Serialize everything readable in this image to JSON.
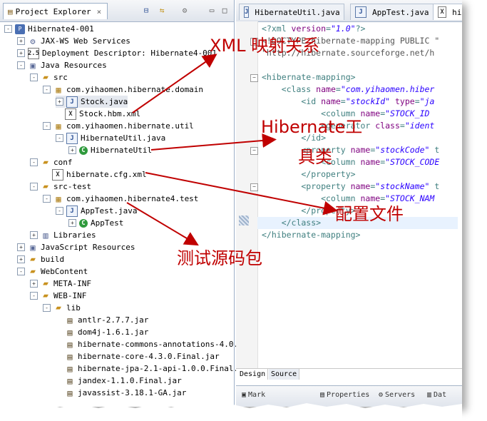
{
  "explorer": {
    "tab_title": "Project Explorer",
    "rows": [
      {
        "label": "Hibernate4-001",
        "indent": 0,
        "exp": "-",
        "icon": "project-icon",
        "glyph": "P",
        "cls": "proj"
      },
      {
        "label": "JAX-WS Web Services",
        "indent": 1,
        "exp": "+",
        "icon": "web-services-icon",
        "glyph": "⚙",
        "cls": "lib"
      },
      {
        "label": "Deployment Descriptor: Hibernate4-001",
        "indent": 1,
        "exp": "+",
        "icon": "deployment-descriptor-icon",
        "glyph": "2.5",
        "cls": "xfile"
      },
      {
        "label": "Java Resources",
        "indent": 1,
        "exp": "-",
        "icon": "java-resources-icon",
        "glyph": "▣",
        "cls": "lib"
      },
      {
        "label": "src",
        "indent": 2,
        "exp": "-",
        "icon": "source-folder-icon",
        "glyph": "▰",
        "cls": "fold"
      },
      {
        "label": "com.yihaomen.hibernate.domain",
        "indent": 3,
        "exp": "-",
        "icon": "package-icon",
        "glyph": "▦",
        "cls": "pkg"
      },
      {
        "label": "Stock.java",
        "indent": 4,
        "exp": "+",
        "icon": "java-file-icon",
        "glyph": "J",
        "cls": "jfile",
        "sel": true
      },
      {
        "label": "Stock.hbm.xml",
        "indent": 4,
        "exp": "",
        "icon": "xml-file-icon",
        "glyph": "X",
        "cls": "xfile"
      },
      {
        "label": "com.yihaomen.hibernate.util",
        "indent": 3,
        "exp": "-",
        "icon": "package-icon",
        "glyph": "▦",
        "cls": "pkg"
      },
      {
        "label": "HibernateUtil.java",
        "indent": 4,
        "exp": "-",
        "icon": "java-file-icon",
        "glyph": "J",
        "cls": "jfile"
      },
      {
        "label": "HibernateUtil",
        "indent": 5,
        "exp": "+",
        "icon": "class-icon",
        "glyph": "C",
        "cls": "cls"
      },
      {
        "label": "conf",
        "indent": 2,
        "exp": "-",
        "icon": "source-folder-icon",
        "glyph": "▰",
        "cls": "fold"
      },
      {
        "label": "hibernate.cfg.xml",
        "indent": 3,
        "exp": "",
        "icon": "xml-file-icon",
        "glyph": "X",
        "cls": "xfile"
      },
      {
        "label": "src-test",
        "indent": 2,
        "exp": "-",
        "icon": "source-folder-icon",
        "glyph": "▰",
        "cls": "fold"
      },
      {
        "label": "com.yihaomen.hibernate4.test",
        "indent": 3,
        "exp": "-",
        "icon": "package-icon",
        "glyph": "▦",
        "cls": "pkg"
      },
      {
        "label": "AppTest.java",
        "indent": 4,
        "exp": "-",
        "icon": "java-file-icon",
        "glyph": "J",
        "cls": "jfile"
      },
      {
        "label": "AppTest",
        "indent": 5,
        "exp": "+",
        "icon": "class-icon",
        "glyph": "C",
        "cls": "cls"
      },
      {
        "label": "Libraries",
        "indent": 2,
        "exp": "+",
        "icon": "libraries-icon",
        "glyph": "▥",
        "cls": "lib"
      },
      {
        "label": "JavaScript Resources",
        "indent": 1,
        "exp": "+",
        "icon": "javascript-resources-icon",
        "glyph": "▣",
        "cls": "lib"
      },
      {
        "label": "build",
        "indent": 1,
        "exp": "+",
        "icon": "folder-icon",
        "glyph": "▰",
        "cls": "fold"
      },
      {
        "label": "WebContent",
        "indent": 1,
        "exp": "-",
        "icon": "folder-icon",
        "glyph": "▰",
        "cls": "fold"
      },
      {
        "label": "META-INF",
        "indent": 2,
        "exp": "+",
        "icon": "folder-icon",
        "glyph": "▰",
        "cls": "fold"
      },
      {
        "label": "WEB-INF",
        "indent": 2,
        "exp": "-",
        "icon": "folder-icon",
        "glyph": "▰",
        "cls": "fold"
      },
      {
        "label": "lib",
        "indent": 3,
        "exp": "-",
        "icon": "folder-icon",
        "glyph": "▰",
        "cls": "fold"
      },
      {
        "label": "antlr-2.7.7.jar",
        "indent": 4,
        "exp": "",
        "icon": "jar-icon",
        "glyph": "▤",
        "cls": "jar"
      },
      {
        "label": "dom4j-1.6.1.jar",
        "indent": 4,
        "exp": "",
        "icon": "jar-icon",
        "glyph": "▤",
        "cls": "jar"
      },
      {
        "label": "hibernate-commons-annotations-4.0.",
        "indent": 4,
        "exp": "",
        "icon": "jar-icon",
        "glyph": "▤",
        "cls": "jar"
      },
      {
        "label": "hibernate-core-4.3.0.Final.jar",
        "indent": 4,
        "exp": "",
        "icon": "jar-icon",
        "glyph": "▤",
        "cls": "jar"
      },
      {
        "label": "hibernate-jpa-2.1-api-1.0.0.Final.",
        "indent": 4,
        "exp": "",
        "icon": "jar-icon",
        "glyph": "▤",
        "cls": "jar"
      },
      {
        "label": "jandex-1.1.0.Final.jar",
        "indent": 4,
        "exp": "",
        "icon": "jar-icon",
        "glyph": "▤",
        "cls": "jar"
      },
      {
        "label": "javassist-3.18.1-GA.jar",
        "indent": 4,
        "exp": "",
        "icon": "jar-icon",
        "glyph": "▤",
        "cls": "jar"
      }
    ]
  },
  "editor": {
    "tabs": [
      {
        "label": "HibernateUtil.java",
        "active": false
      },
      {
        "label": "AppTest.java",
        "active": false
      },
      {
        "label": "hib",
        "active": true
      }
    ],
    "lines": [
      [
        [
          "tag",
          "<?xml "
        ],
        [
          "attr",
          "version"
        ],
        [
          "tag",
          "="
        ],
        [
          "val",
          "\"1.0\""
        ],
        [
          "tag",
          "?>"
        ]
      ],
      [
        [
          "cmt",
          "<!DOCTYPE hibernate-mapping PUBLIC \""
        ]
      ],
      [
        [
          "cmt",
          "\"http://hibernate.sourceforge.net/h"
        ]
      ],
      [],
      [
        [
          "tag",
          "<hibernate-mapping>"
        ]
      ],
      [
        [
          "tag",
          "    <class "
        ],
        [
          "attr",
          "name"
        ],
        [
          "tag",
          "="
        ],
        [
          "val",
          "\"com.yihaomen.hiber"
        ]
      ],
      [
        [
          "tag",
          "        <id "
        ],
        [
          "attr",
          "name"
        ],
        [
          "tag",
          "="
        ],
        [
          "val",
          "\"stockId\""
        ],
        [
          "tag",
          " "
        ],
        [
          "attr",
          "type"
        ],
        [
          "tag",
          "="
        ],
        [
          "val",
          "\"ja"
        ]
      ],
      [
        [
          "tag",
          "            <column "
        ],
        [
          "attr",
          "name"
        ],
        [
          "tag",
          "="
        ],
        [
          "val",
          "\"STOCK_ID"
        ]
      ],
      [
        [
          "tag",
          "            <generator "
        ],
        [
          "attr",
          "class"
        ],
        [
          "tag",
          "="
        ],
        [
          "val",
          "\"ident"
        ]
      ],
      [
        [
          "tag",
          "        </id>"
        ]
      ],
      [
        [
          "tag",
          "        <property "
        ],
        [
          "attr",
          "name"
        ],
        [
          "tag",
          "="
        ],
        [
          "val",
          "\"stockCode\""
        ],
        [
          "tag",
          " t"
        ]
      ],
      [
        [
          "tag",
          "            <column "
        ],
        [
          "attr",
          "name"
        ],
        [
          "tag",
          "="
        ],
        [
          "val",
          "\"STOCK_CODE"
        ]
      ],
      [
        [
          "tag",
          "        </property>"
        ]
      ],
      [
        [
          "tag",
          "        <property "
        ],
        [
          "attr",
          "name"
        ],
        [
          "tag",
          "="
        ],
        [
          "val",
          "\"stockName\""
        ],
        [
          "tag",
          " t"
        ]
      ],
      [
        [
          "tag",
          "            <column "
        ],
        [
          "attr",
          "name"
        ],
        [
          "tag",
          "="
        ],
        [
          "val",
          "\"STOCK_NAM"
        ]
      ],
      [
        [
          "tag",
          "        </property>"
        ]
      ],
      [
        [
          "tag",
          "    </class>"
        ]
      ],
      [
        [
          "tag",
          "</hibernate-mapping>"
        ]
      ]
    ],
    "bottom_tabs": [
      "Design",
      "Source"
    ],
    "views": [
      "Mark",
      "Properties",
      "Servers",
      "Dat"
    ]
  },
  "annotations": [
    {
      "text": "XML 映射关系"
    },
    {
      "text": "Hibernate工"
    },
    {
      "text": "具类"
    },
    {
      "text": "配置文件"
    },
    {
      "text": "测试源码包"
    }
  ],
  "colors": {
    "annotation": "#c00000",
    "tag": "#3f7f7f",
    "attr": "#7f007f",
    "value": "#2a00ff"
  }
}
